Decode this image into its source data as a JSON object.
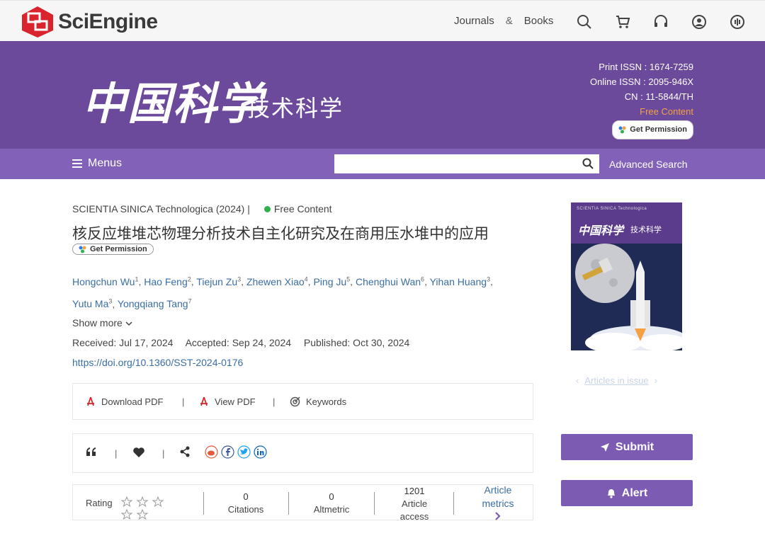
{
  "header": {
    "logo_text": "SciEngine",
    "nav": [
      "Journals",
      "&",
      "Books"
    ]
  },
  "banner": {
    "brand_cn": "中国科学",
    "brand_sub": "技术科学",
    "print_issn": "Print ISSN : 1674-7259",
    "online_issn": "Online ISSN : 2095-946X",
    "cn": "CN : 11-5844/TH",
    "free_content": "Free Content",
    "get_permission": "Get Permission"
  },
  "menubar": {
    "menus_label": "Menus",
    "search_placeholder": "",
    "advanced_search": "Advanced Search"
  },
  "article": {
    "journal": "SCIENTIA SINICA Technologica (2024) |",
    "free_content": "Free Content",
    "title": "核反应堆堆芯物理分析技术自主化研究及在商用压水堆中的应用",
    "get_permission": "Get Permission",
    "authors": [
      {
        "name": "Hongchun Wu",
        "sup": "1"
      },
      {
        "name": "Hao Feng",
        "sup": "2"
      },
      {
        "name": "Tiejun Zu",
        "sup": "3"
      },
      {
        "name": "Zhewen Xiao",
        "sup": "4"
      },
      {
        "name": "Ping Ju",
        "sup": "5"
      },
      {
        "name": "Chenghui Wan",
        "sup": "6"
      },
      {
        "name": "Yihan Huang",
        "sup": "3"
      },
      {
        "name": "Yutu Ma",
        "sup": "3"
      },
      {
        "name": "Yongqiang Tang",
        "sup": "7"
      }
    ],
    "show_more": "Show more",
    "received": "Received: Jul 17, 2024",
    "accepted": "Accepted: Sep 24, 2024",
    "published": "Published: Oct 30, 2024",
    "doi": "https://doi.org/10.1360/SST-2024-0176"
  },
  "actions": {
    "download_pdf": "Download PDF",
    "view_pdf": "View PDF",
    "keywords": "Keywords",
    "pipe": "|"
  },
  "metrics": {
    "rating_label": "Rating",
    "citations_value": "0",
    "citations_label": "Citations",
    "altmetric_value": "0",
    "altmetric_label": "Altmetric",
    "access_value": "1201",
    "access_label_1": "Article",
    "access_label_2": "access",
    "article_metrics_1": "Article",
    "article_metrics_2": "metrics"
  },
  "sidebar": {
    "cover_head": "SCIENTIA SINICA Technologica",
    "cover_title": "中国科学",
    "cover_sub": "技术科学",
    "articles_in_issue": "Articles in issue",
    "submit": "Submit",
    "alert": "Alert"
  },
  "colors": {
    "banner": "#6b4a9c",
    "menubar": "#8262b8",
    "button": "#7c5cb2",
    "link": "#3a6ea5",
    "free": "#f5a142"
  }
}
